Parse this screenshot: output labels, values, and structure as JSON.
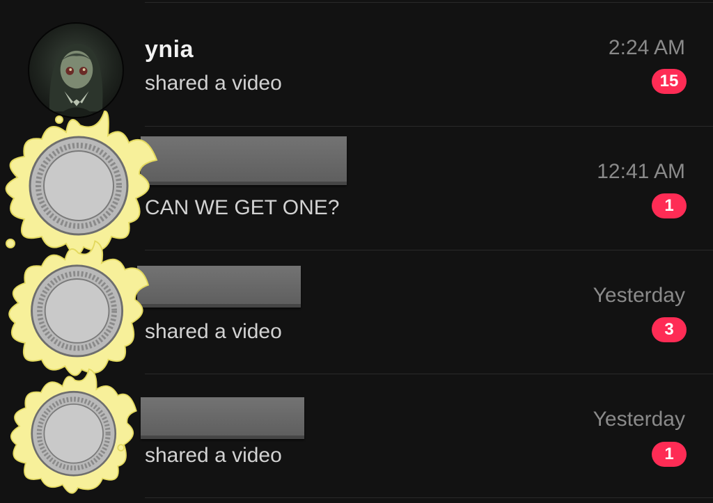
{
  "conversations": [
    {
      "name": "ynia",
      "preview": "shared a video",
      "time": "2:24 AM",
      "unread": "15",
      "avatar_icon": "anime-girl-avatar-icon",
      "name_redacted": false
    },
    {
      "name": "",
      "preview": "CAN WE GET ONE?",
      "time": "12:41 AM",
      "unread": "1",
      "avatar_icon": "coin-splash-sticker-icon",
      "name_redacted": true
    },
    {
      "name": "",
      "preview": "shared a video",
      "time": "Yesterday",
      "unread": "3",
      "avatar_icon": "coin-splash-sticker-icon",
      "name_redacted": true
    },
    {
      "name": "",
      "preview": "shared a video",
      "time": "Yesterday",
      "unread": "1",
      "avatar_icon": "coin-splash-sticker-icon",
      "name_redacted": true
    }
  ],
  "colors": {
    "background": "#121212",
    "badge": "#fe2c55",
    "splash": "#f7f09a",
    "coin": "#c9c9c9"
  }
}
